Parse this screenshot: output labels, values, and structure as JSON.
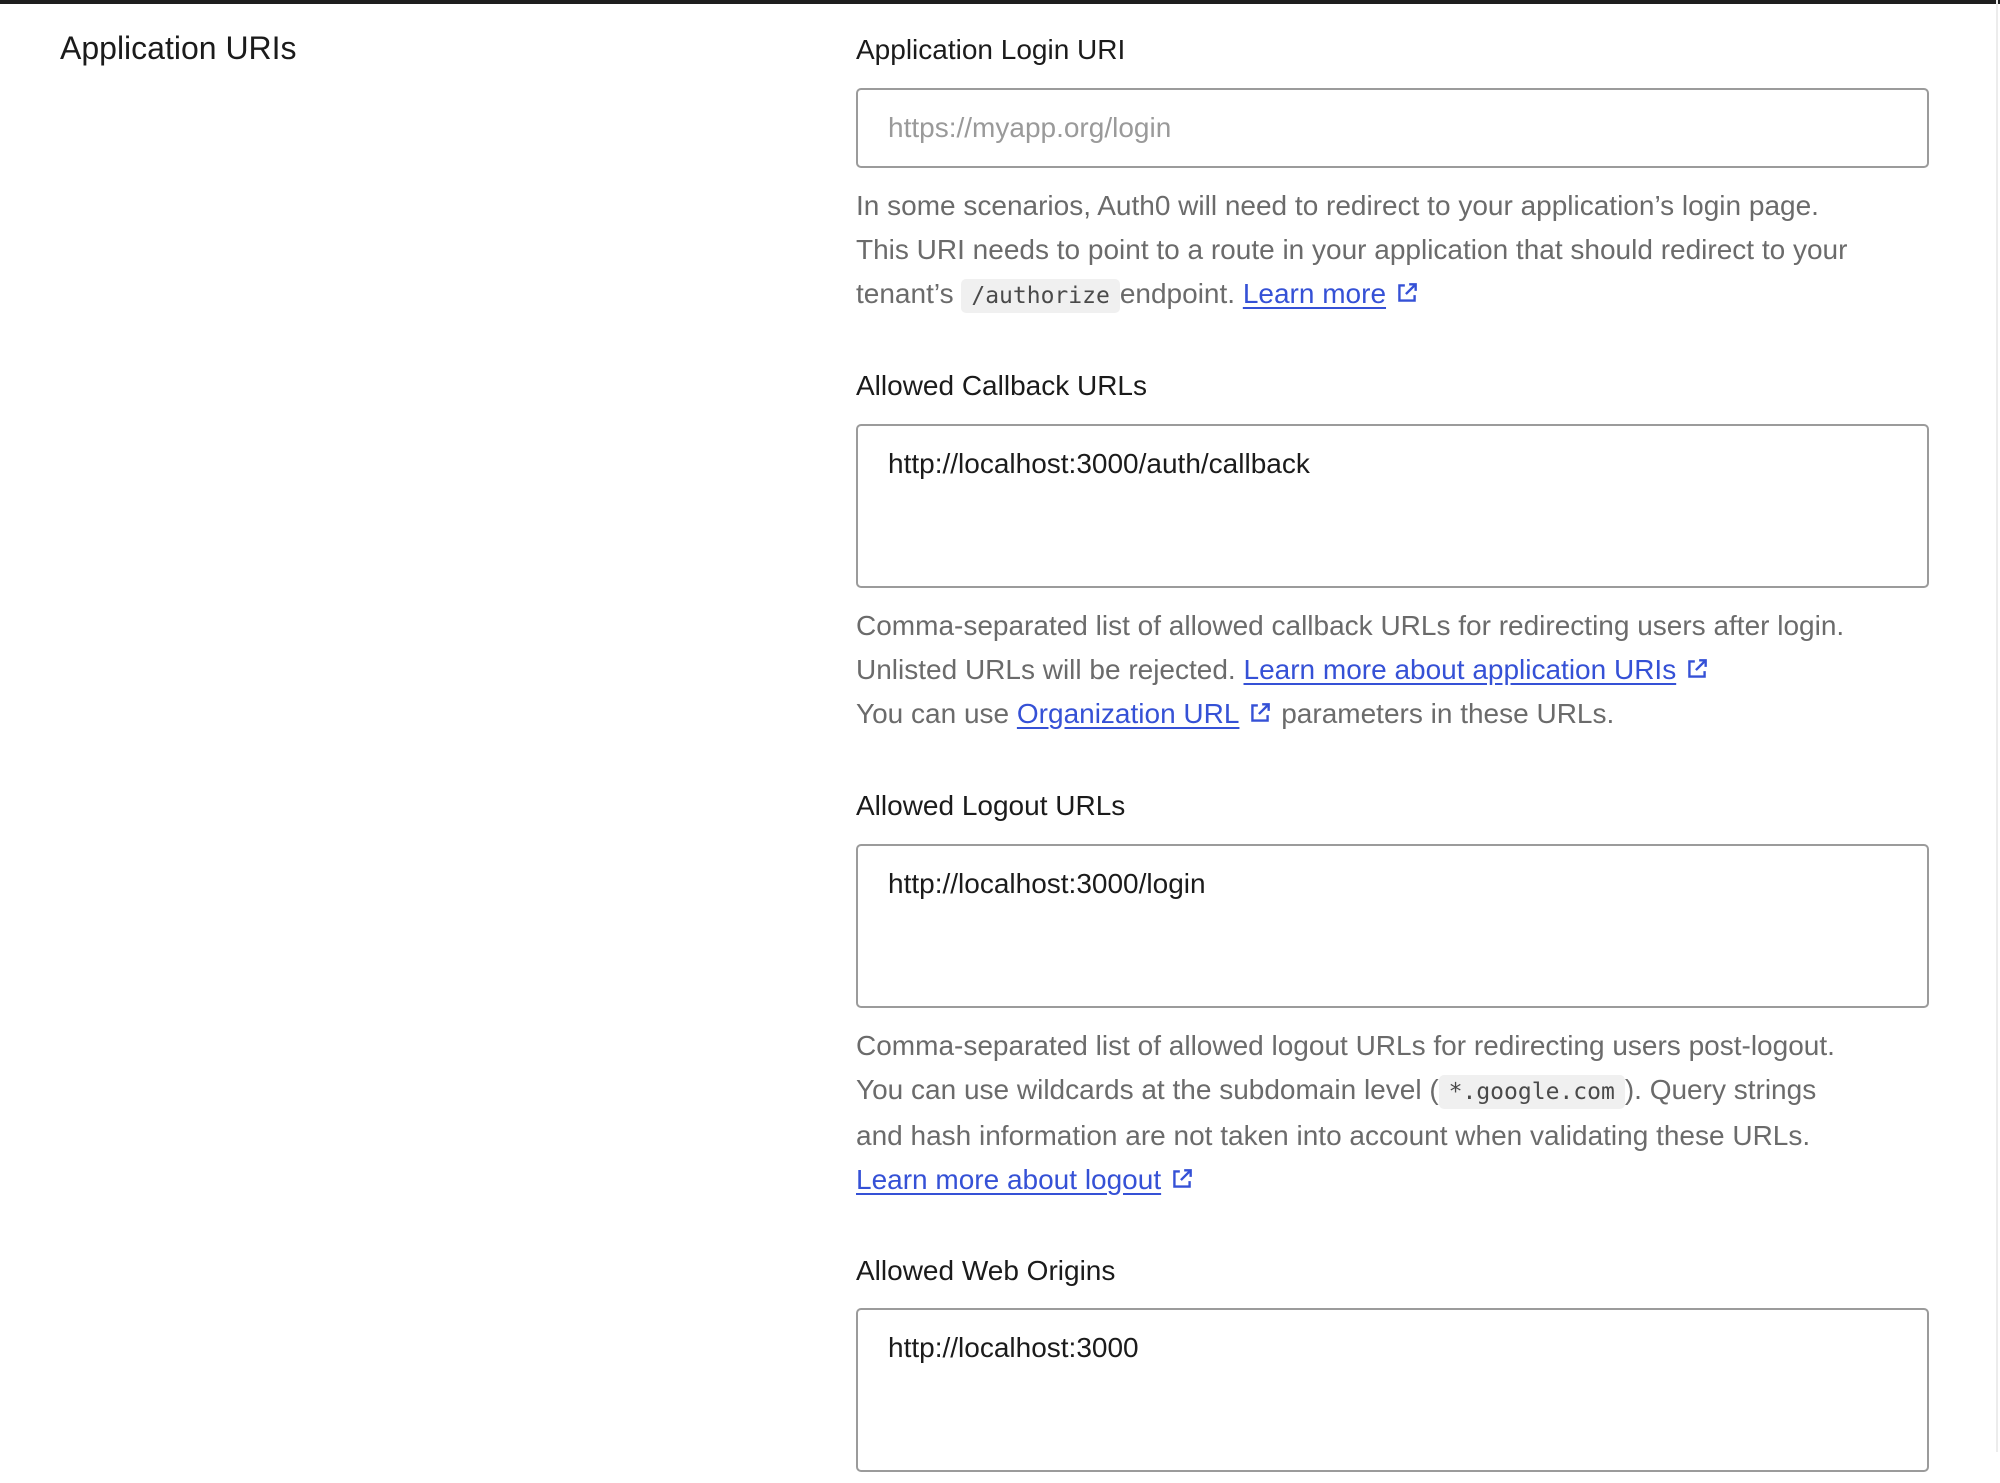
{
  "section": {
    "title": "Application URIs"
  },
  "login_uri": {
    "label": "Application Login URI",
    "value": "",
    "placeholder": "https://myapp.org/login",
    "help": {
      "line1": "In some scenarios, Auth0 will need to redirect to your application’s login page.",
      "line2": "This URI needs to point to a route in your application that should redirect to your",
      "pre_code": "tenant’s ",
      "code": "/authorize",
      "post_code": "endpoint. ",
      "link": "Learn more"
    }
  },
  "callback_urls": {
    "label": "Allowed Callback URLs",
    "value": "http://localhost:3000/auth/callback",
    "help": {
      "line1": "Comma-separated list of allowed callback URLs for redirecting users after login.",
      "line2_text": "Unlisted URLs will be rejected. ",
      "line2_link": "Learn more about application URIs",
      "line3_pre": "You can use ",
      "line3_link": "Organization URL",
      "line3_post": " parameters in these URLs."
    }
  },
  "logout_urls": {
    "label": "Allowed Logout URLs",
    "value": "http://localhost:3000/login",
    "help": {
      "line1": "Comma-separated list of allowed logout URLs for redirecting users post-logout.",
      "line2_pre": "You can use wildcards at the subdomain level (",
      "code": "*.google.com",
      "line2_post": "). Query strings",
      "line3": "and hash information are not taken into account when validating these URLs.",
      "link": "Learn more about logout"
    }
  },
  "web_origins": {
    "label": "Allowed Web Origins",
    "value": "http://localhost:3000"
  },
  "icons": {
    "external_link": "external-link-icon"
  },
  "colors": {
    "link": "#3551d6",
    "help_text": "#6b6b6b",
    "border": "#9b9b9b"
  }
}
